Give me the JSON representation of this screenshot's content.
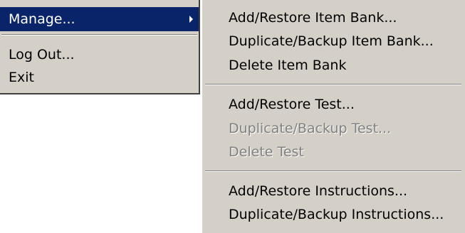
{
  "main_menu": {
    "items": [
      {
        "label": "Manage...",
        "highlighted": true,
        "has_submenu": true
      },
      {
        "label": "Log Out..."
      },
      {
        "label": "Exit"
      }
    ]
  },
  "submenu": {
    "groups": [
      [
        {
          "label": "Add/Restore Item Bank...",
          "enabled": true
        },
        {
          "label": "Duplicate/Backup Item Bank...",
          "enabled": true
        },
        {
          "label": "Delete Item Bank",
          "enabled": true
        }
      ],
      [
        {
          "label": "Add/Restore Test...",
          "enabled": true
        },
        {
          "label": "Duplicate/Backup Test...",
          "enabled": false
        },
        {
          "label": "Delete Test",
          "enabled": false
        }
      ],
      [
        {
          "label": "Add/Restore Instructions...",
          "enabled": true
        },
        {
          "label": "Duplicate/Backup Instructions...",
          "enabled": true
        }
      ]
    ]
  },
  "colors": {
    "menu_background": "#d4d0c8",
    "highlight": "#0a246a",
    "disabled_text": "#808080"
  }
}
